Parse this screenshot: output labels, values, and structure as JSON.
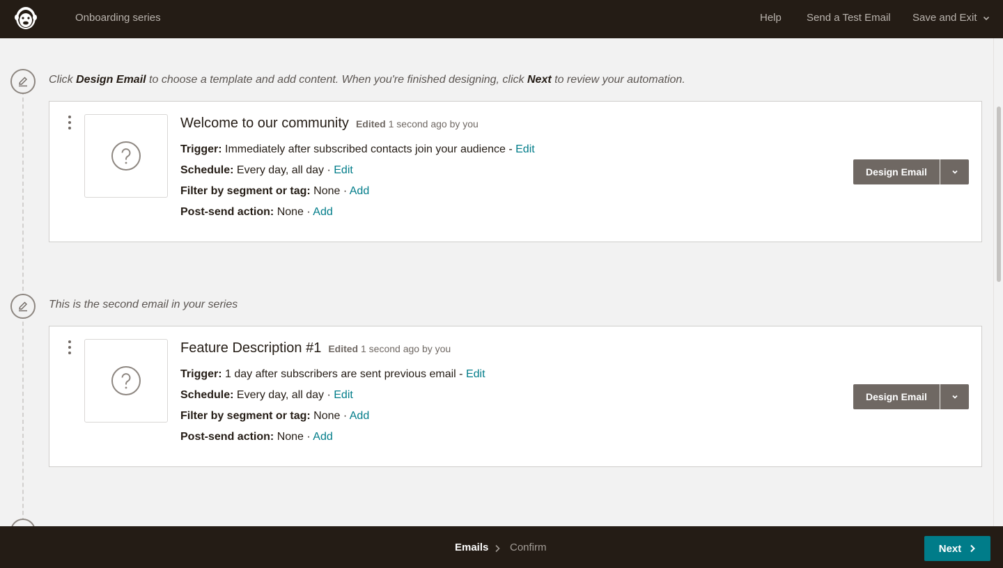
{
  "topbar": {
    "title": "Onboarding series",
    "help_label": "Help",
    "test_email_label": "Send a Test Email",
    "save_exit_label": "Save and Exit",
    "logo_icon": "mailchimp-freddie-logo"
  },
  "intro": {
    "prefix": "Click ",
    "bold1": "Design Email",
    "middle": " to choose a template and add content. When you're finished designing, click ",
    "bold2": "Next",
    "suffix": " to review your automation."
  },
  "emails": [
    {
      "title": "Welcome to our community",
      "edited_word": "Edited",
      "edited_rest": "1 second ago by you",
      "trigger_label": "Trigger:",
      "trigger_value": "Immediately after subscribed contacts join your audience -",
      "trigger_link": "Edit",
      "schedule_label": "Schedule:",
      "schedule_value": "Every day, all day ·",
      "schedule_link": "Edit",
      "filter_label": "Filter by segment or tag:",
      "filter_value": "None ·",
      "filter_link": "Add",
      "postsend_label": "Post-send action:",
      "postsend_value": "None ·",
      "postsend_link": "Add",
      "design_label": "Design Email"
    },
    {
      "caption": "This is the second email in your series",
      "title": "Feature Description #1",
      "edited_word": "Edited",
      "edited_rest": "1 second ago by you",
      "trigger_label": "Trigger:",
      "trigger_value": "1 day after subscribers are sent previous email -",
      "trigger_link": "Edit",
      "schedule_label": "Schedule:",
      "schedule_value": "Every day, all day ·",
      "schedule_link": "Edit",
      "filter_label": "Filter by segment or tag:",
      "filter_value": "None ·",
      "filter_link": "Add",
      "postsend_label": "Post-send action:",
      "postsend_value": "None ·",
      "postsend_link": "Add",
      "design_label": "Design Email"
    }
  ],
  "footer": {
    "step_current": "Emails",
    "step_next": "Confirm",
    "next_label": "Next"
  },
  "colors": {
    "topbar": "#241c15",
    "link": "#007c89",
    "design_button": "#6f6863",
    "next_button": "#007c89"
  }
}
